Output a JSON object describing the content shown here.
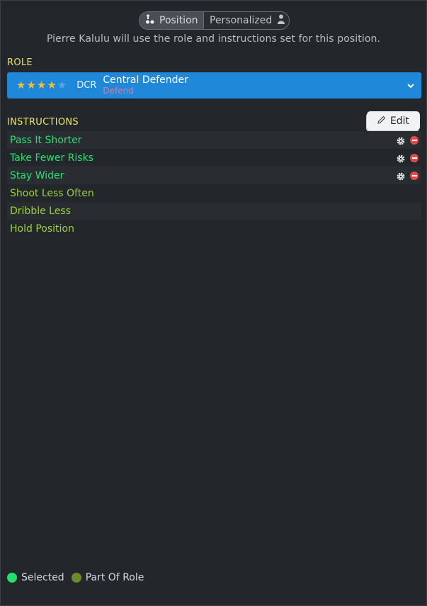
{
  "toggle": {
    "position_label": "Position",
    "personalized_label": "Personalized",
    "position_icon": "position-icon",
    "personalized_icon": "person-icon"
  },
  "subtext": "Pierre Kalulu will use the role and instructions set for this position.",
  "role": {
    "section_label": "ROLE",
    "stars_filled": 4,
    "stars_total": 5,
    "position_code": "DCR",
    "name": "Central Defender",
    "duty": "Defend",
    "bar_color": "#1f88d9"
  },
  "instructions": {
    "section_label": "INSTRUCTIONS",
    "edit_label": "Edit",
    "items": [
      {
        "label": "Pass It Shorter",
        "type": "selected"
      },
      {
        "label": "Take Fewer Risks",
        "type": "selected"
      },
      {
        "label": "Stay Wider",
        "type": "selected"
      },
      {
        "label": "Shoot Less Often",
        "type": "role"
      },
      {
        "label": "Dribble Less",
        "type": "role"
      },
      {
        "label": "Hold Position",
        "type": "role"
      }
    ]
  },
  "legend": {
    "selected_label": "Selected",
    "selected_color": "#22e06a",
    "role_label": "Part Of Role",
    "role_color": "#6b8a2c"
  }
}
